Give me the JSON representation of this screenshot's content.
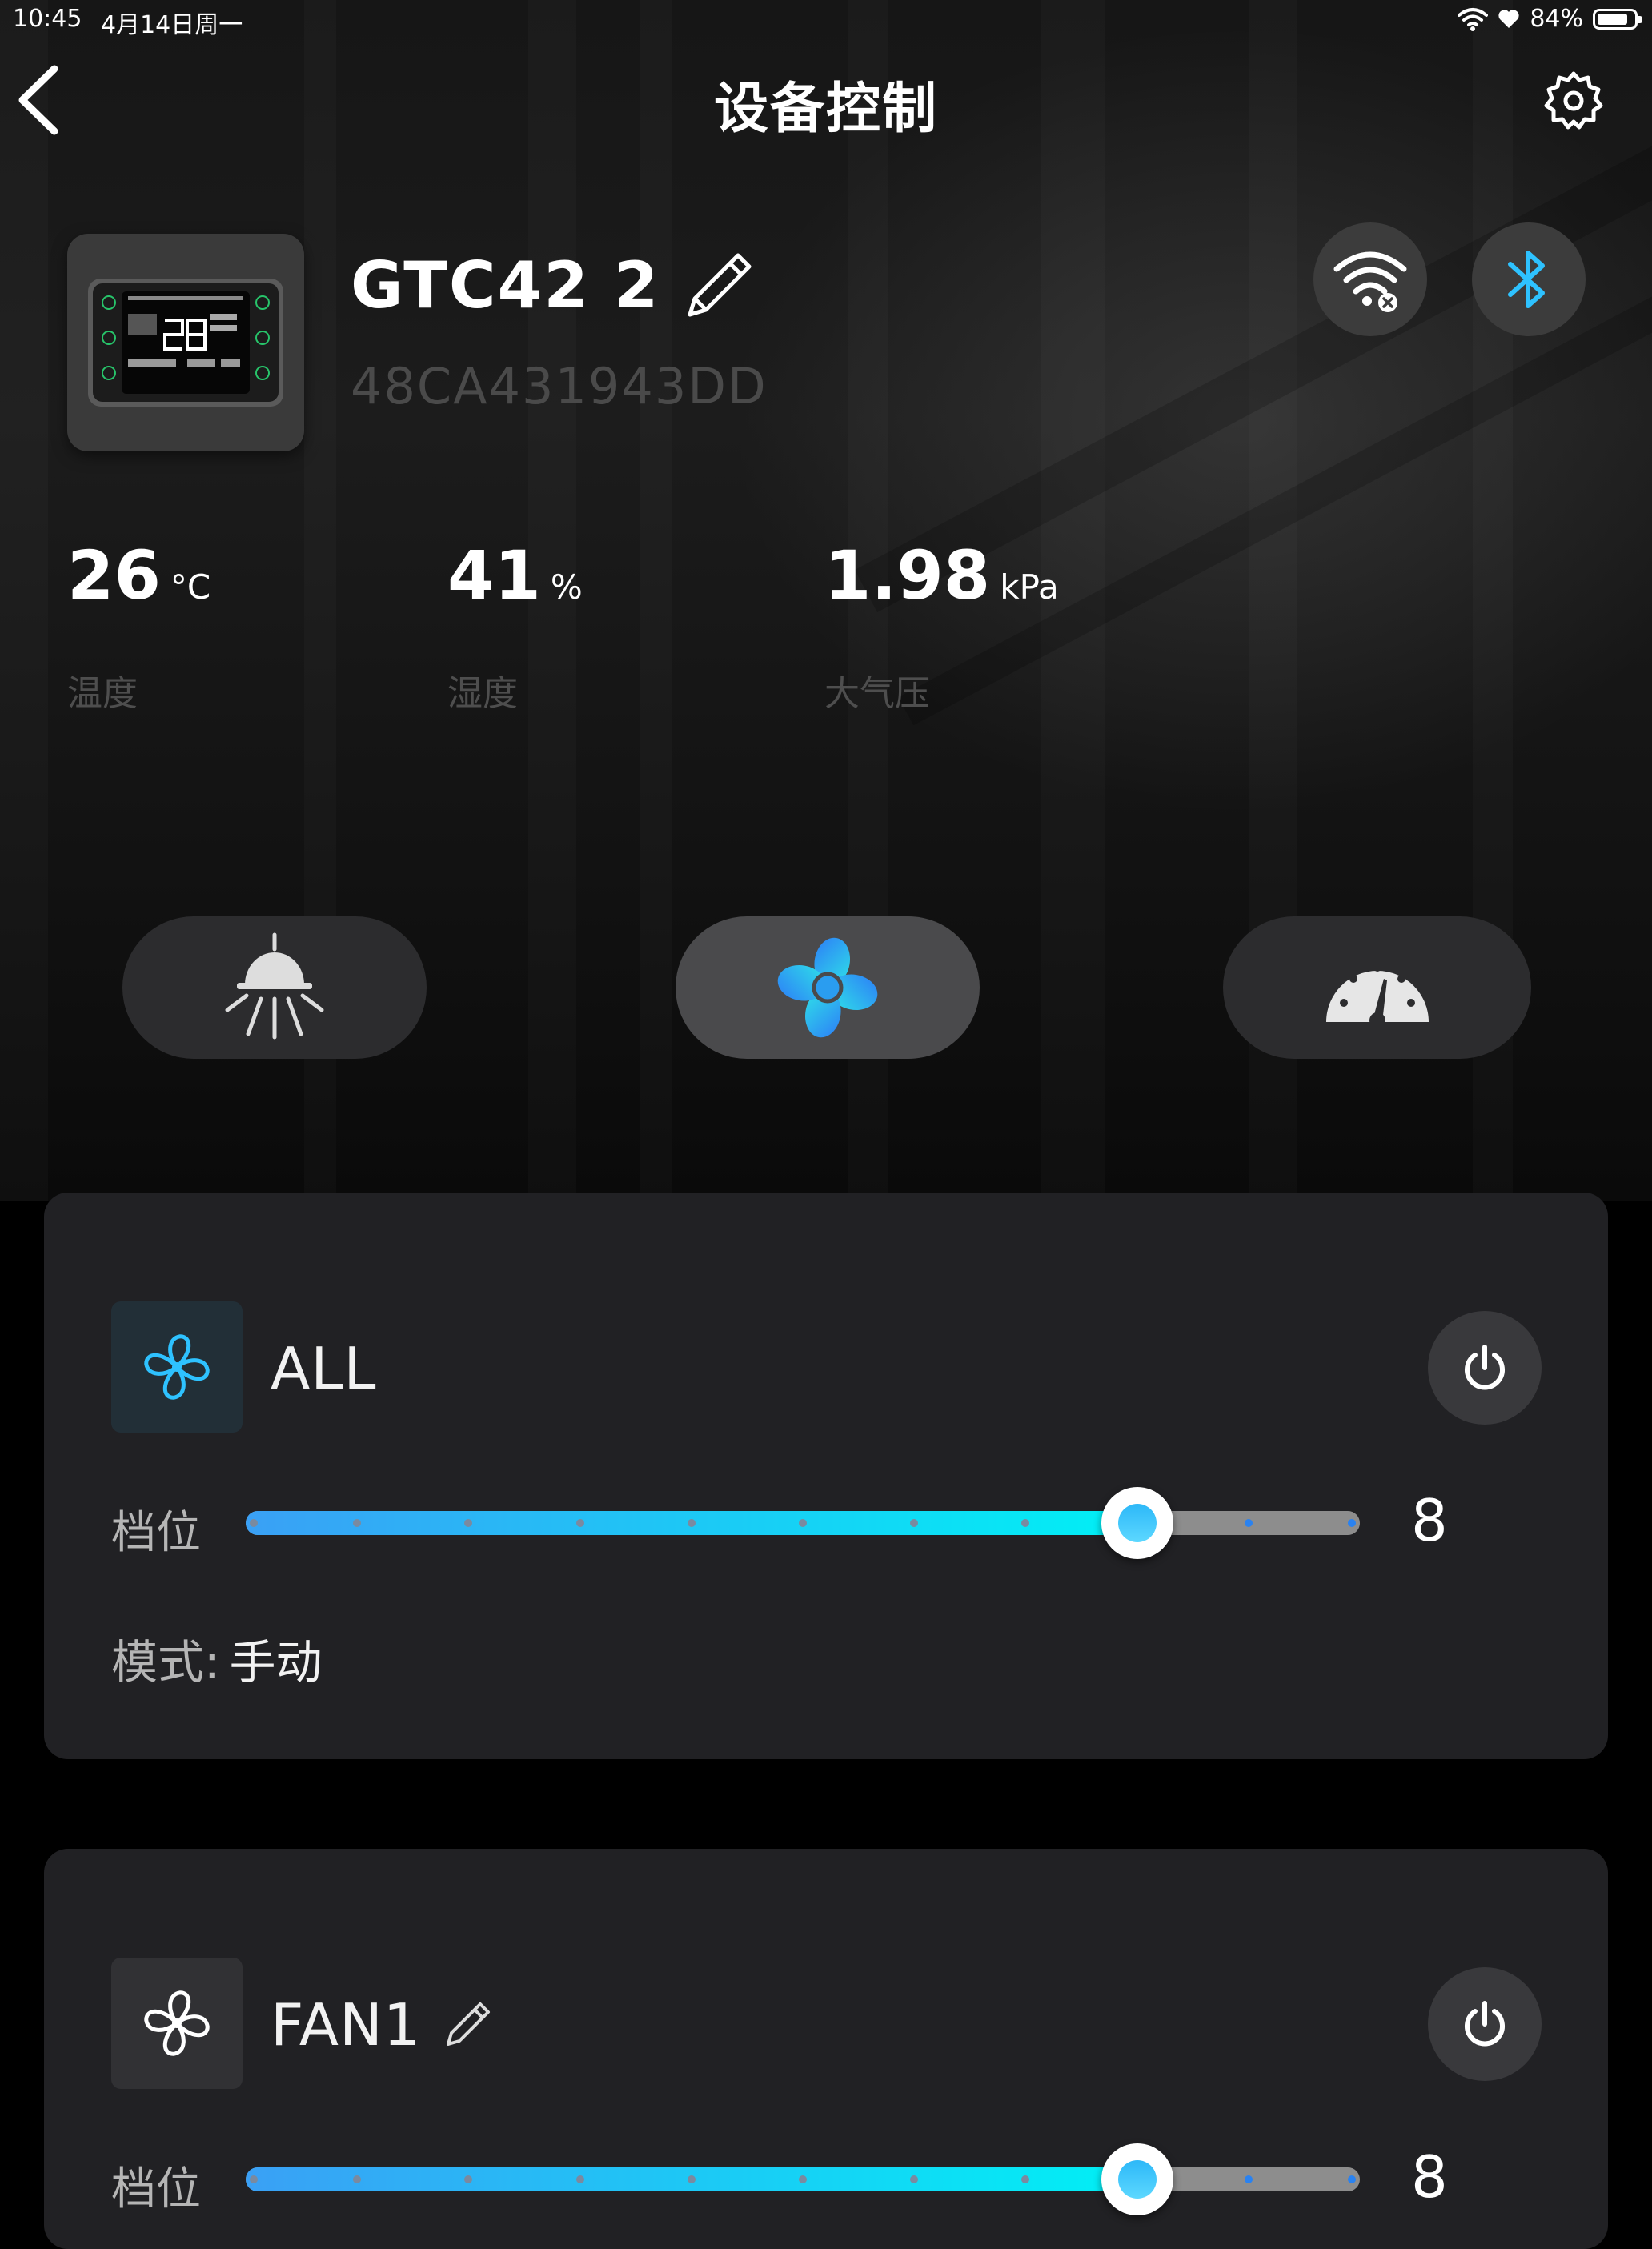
{
  "status_bar": {
    "time": "10:45",
    "date": "4月14日周一",
    "battery_percent": "84%",
    "battery_level": 0.84
  },
  "header": {
    "title": "设备控制"
  },
  "device": {
    "name": "GTC42 2",
    "mac": "48CA431943DD"
  },
  "sensors": [
    {
      "value": "26",
      "unit": "°C",
      "label": "温度"
    },
    {
      "value": "41",
      "unit": "%",
      "label": "湿度"
    },
    {
      "value": "1.98",
      "unit": "kPa",
      "label": "大气压"
    }
  ],
  "mode_tabs": [
    {
      "icon": "light-icon",
      "active": false
    },
    {
      "icon": "fan-icon",
      "active": true
    },
    {
      "icon": "gauge-icon",
      "active": false
    }
  ],
  "cards": [
    {
      "title": "ALL",
      "gear_label": "档位",
      "gear_value": "8",
      "gear_max": 10,
      "mode_label": "模式:",
      "mode_value": "手动",
      "editable": false,
      "icon_color": "#2ec2ff"
    },
    {
      "title": "FAN1",
      "gear_label": "档位",
      "gear_value": "8",
      "gear_max": 10,
      "editable": true,
      "icon_color": "#ffffff"
    }
  ],
  "colors": {
    "accent_cyan": "#00f0f5",
    "accent_blue": "#3aa0f5",
    "bluetooth": "#2ec2ff"
  }
}
